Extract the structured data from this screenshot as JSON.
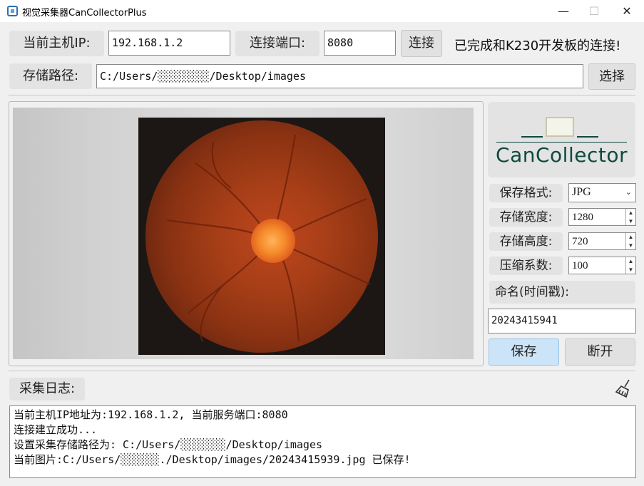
{
  "window": {
    "title": "视觉采集器CanCollectorPlus",
    "controls": [
      "—",
      "☐",
      "✕"
    ]
  },
  "connection": {
    "host_ip_label": "当前主机IP:",
    "host_ip_value": "192.168.1.2",
    "port_label": "连接端口:",
    "port_value": "8080",
    "connect_button": "连接",
    "status_text": "已完成和K230开发板的连接!"
  },
  "storage": {
    "path_label": "存储路径:",
    "path_value": "C:/Users/░░░░░░░░/Desktop/images",
    "choose_button": "选择"
  },
  "logo": {
    "text": "CanCollector",
    "color": "#0f4a3f"
  },
  "settings": {
    "format_label": "保存格式:",
    "format_value": "JPG",
    "width_label": "存储宽度:",
    "width_value": "1280",
    "height_label": "存储高度:",
    "height_value": "720",
    "compress_label": "压缩系数:",
    "compress_value": "100",
    "name_label": "命名(时间戳):",
    "name_value": "20243415941",
    "save_button": "保存",
    "disconnect_button": "断开"
  },
  "log": {
    "label": "采集日志:",
    "lines": [
      "当前主机IP地址为:192.168.1.2, 当前服务端口:8080",
      "连接建立成功...",
      "设置采集存储路径为: C:/Users/░░░░░░░/Desktop/images",
      "当前图片:C:/Users/░░░░░░./Desktop/images/20243415939.jpg 已保存!"
    ]
  },
  "icons": {
    "clear_log": "broom-icon",
    "app": "app-icon"
  },
  "colors": {
    "save_button_bg": "#cce4f7",
    "save_button_border": "#9ac3e6"
  }
}
